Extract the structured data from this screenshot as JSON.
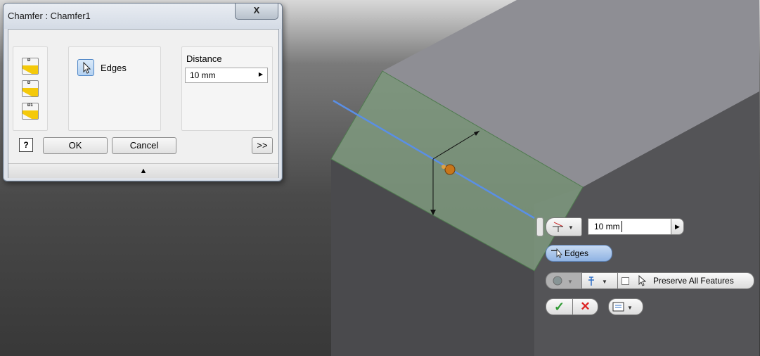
{
  "dialog": {
    "title": "Chamfer : Chamfer1",
    "close_label": "X",
    "edges_label": "Edges",
    "distance_label": "Distance",
    "distance_value": "10 mm",
    "help_label": "?",
    "ok_label": "OK",
    "cancel_label": "Cancel",
    "more_label": ">>",
    "collapse_glyph": "▲",
    "chamfer_type_icons": [
      "distance-chamfer-icon",
      "distance-angle-chamfer-icon",
      "two-distance-chamfer-icon"
    ]
  },
  "minitoolbar": {
    "distance_value": "10 mm",
    "edges_label": "Edges",
    "preserve_label": "Preserve All Features",
    "ok_glyph": "✓",
    "cancel_glyph": "✕",
    "dropdown_glyph": "▼",
    "arrow_glyph": "▶"
  },
  "colors": {
    "edge_highlight": "#5a8fe6",
    "chamfer_face": "#7f9a7f",
    "dialog_bg": "#f0f0f0",
    "ok_green": "#2e9a33",
    "cancel_red": "#dd2222"
  }
}
